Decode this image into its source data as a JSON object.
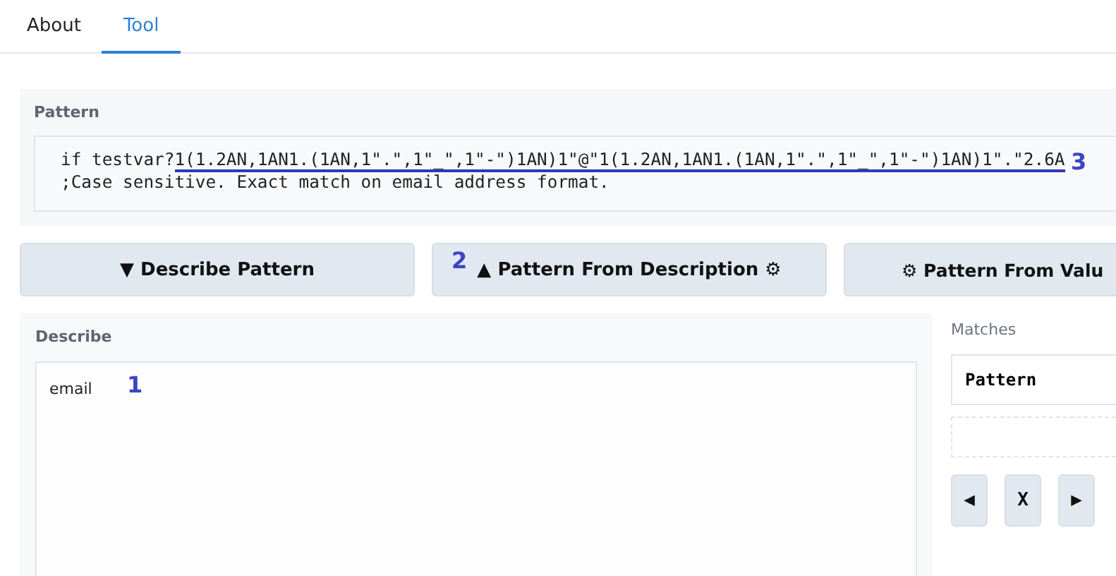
{
  "tabs": [
    {
      "label": "About",
      "selected": false
    },
    {
      "label": "Tool",
      "selected": true
    }
  ],
  "pattern": {
    "label": "Pattern",
    "lead": "if testvar?",
    "highlight": "1(1.2AN,1AN1.(1AN,1\".\",1\"_\",1\"-\")1AN)1\"@\"1(1.2AN,1AN1.(1AN,1\".\",1\"_\",1\"-\")1AN)1\".\"2.6A",
    "line2": ";Case sensitive. Exact match on email address format.",
    "callout": "3"
  },
  "actions": [
    {
      "label": "▼ Describe Pattern"
    },
    {
      "label": "▲ Pattern From Description ⚙",
      "callout": "2"
    },
    {
      "label": "⚙ Pattern From Valu"
    }
  ],
  "describe": {
    "label": "Describe",
    "value": "email",
    "callout": "1"
  },
  "matches": {
    "label": "Matches",
    "pattern_field": "Pattern",
    "buttons": [
      "◀",
      "X",
      "▶"
    ]
  }
}
